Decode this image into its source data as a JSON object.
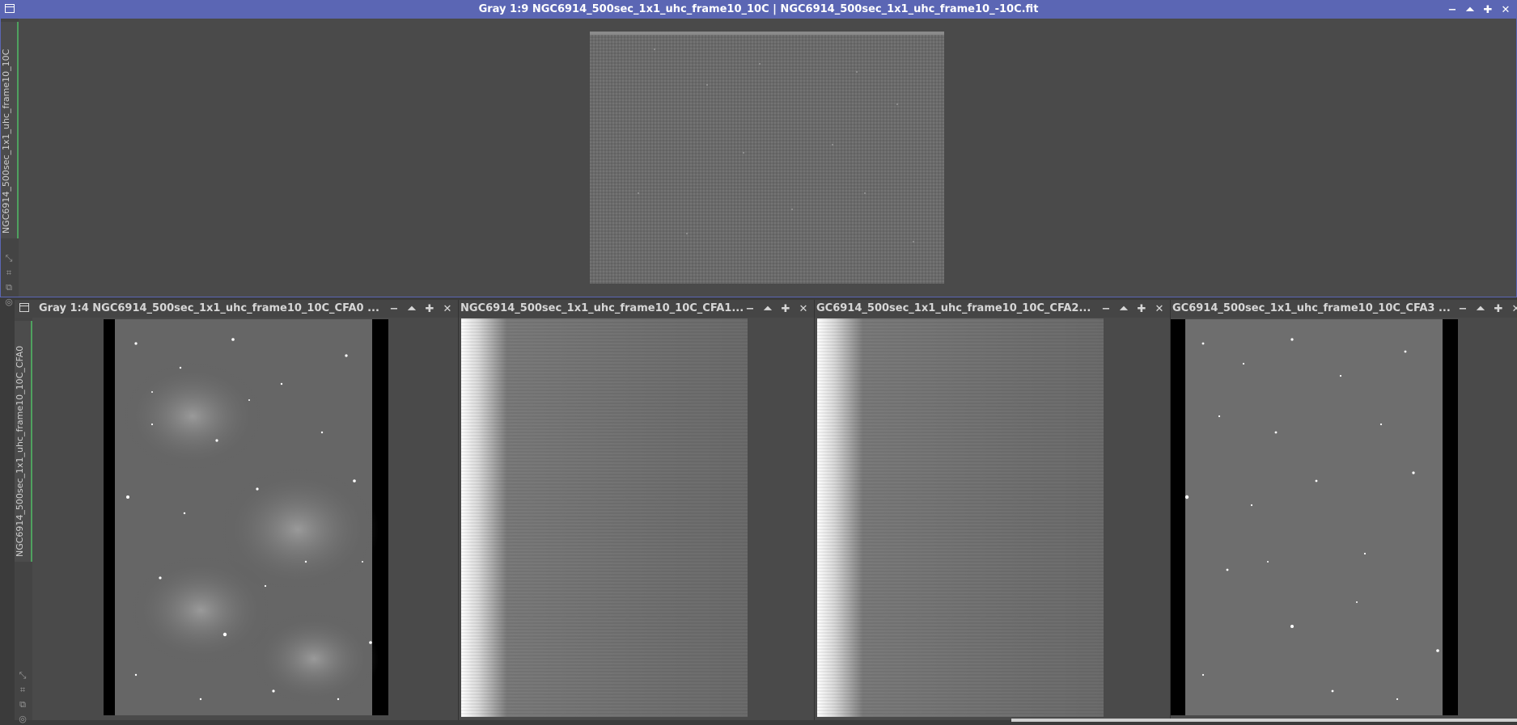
{
  "top_window": {
    "title": "Gray 1:9 NGC6914_500sec_1x1_uhc_frame10_10C | NGC6914_500sec_1x1_uhc_frame10_-10C.fit",
    "side_tab": "NGC6914_500sec_1x1_uhc_frame10_10C",
    "controls": [
      "minimize",
      "shade",
      "maximize",
      "close"
    ]
  },
  "bottom_windows": [
    {
      "title": "Gray 1:4 NGC6914_500sec_1x1_uhc_frame10_10C_CFA0 ...",
      "side_tab": "NGC6914_500sec_1x1_uhc_frame10_10C_CFA0"
    },
    {
      "title": "NGC6914_500sec_1x1_uhc_frame10_10C_CFA1..."
    },
    {
      "title": "GC6914_500sec_1x1_uhc_frame10_10C_CFA2..."
    },
    {
      "title": "GC6914_500sec_1x1_uhc_frame10_10C_CFA3 ..."
    }
  ],
  "icons": {
    "control_minimize": "−",
    "control_shade": "⏶",
    "control_maximize": "✚",
    "control_close": "✕",
    "tool_zoom_fit": "⤡",
    "tool_fit_window": "⌗",
    "tool_clone": "⧉",
    "tool_target": "◎"
  },
  "colors": {
    "active_title": "#5b66b4",
    "inactive_title": "#454545",
    "viewport_bg": "#4a4a4a",
    "tab_accent": "#4fa15f"
  }
}
